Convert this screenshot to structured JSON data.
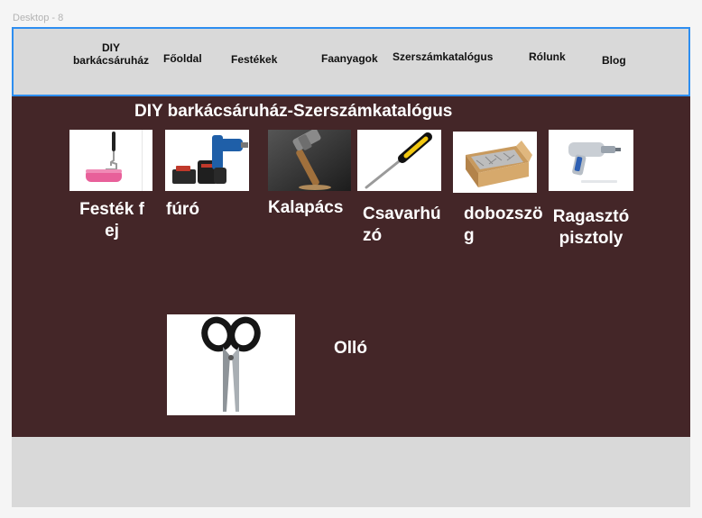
{
  "frame": {
    "label": "Desktop - 8"
  },
  "nav": {
    "brand": "DIY barkácsáruház",
    "items": [
      "Főoldal",
      "Festékek",
      "Faanyagok",
      "Szerszámkatalógus",
      "Rólunk",
      "Blog"
    ]
  },
  "page": {
    "title": "DIY barkácsáruház-Szerszámkatalógus"
  },
  "products": [
    {
      "label": "Festék fej",
      "icon": "paint-roller"
    },
    {
      "label": "fúró",
      "icon": "cordless-drill"
    },
    {
      "label": "Kalapács",
      "icon": "hammer"
    },
    {
      "label": "Csavarhúzó",
      "icon": "screwdriver"
    },
    {
      "label": "dobozszög",
      "icon": "box-of-nails"
    },
    {
      "label": "Ragasztópisztoly",
      "icon": "glue-gun"
    },
    {
      "label": "Olló",
      "icon": "scissors"
    }
  ],
  "colors": {
    "content_bg": "#442628",
    "nav_bg": "#d9d9d9",
    "selection_border": "#2d8ef0"
  }
}
